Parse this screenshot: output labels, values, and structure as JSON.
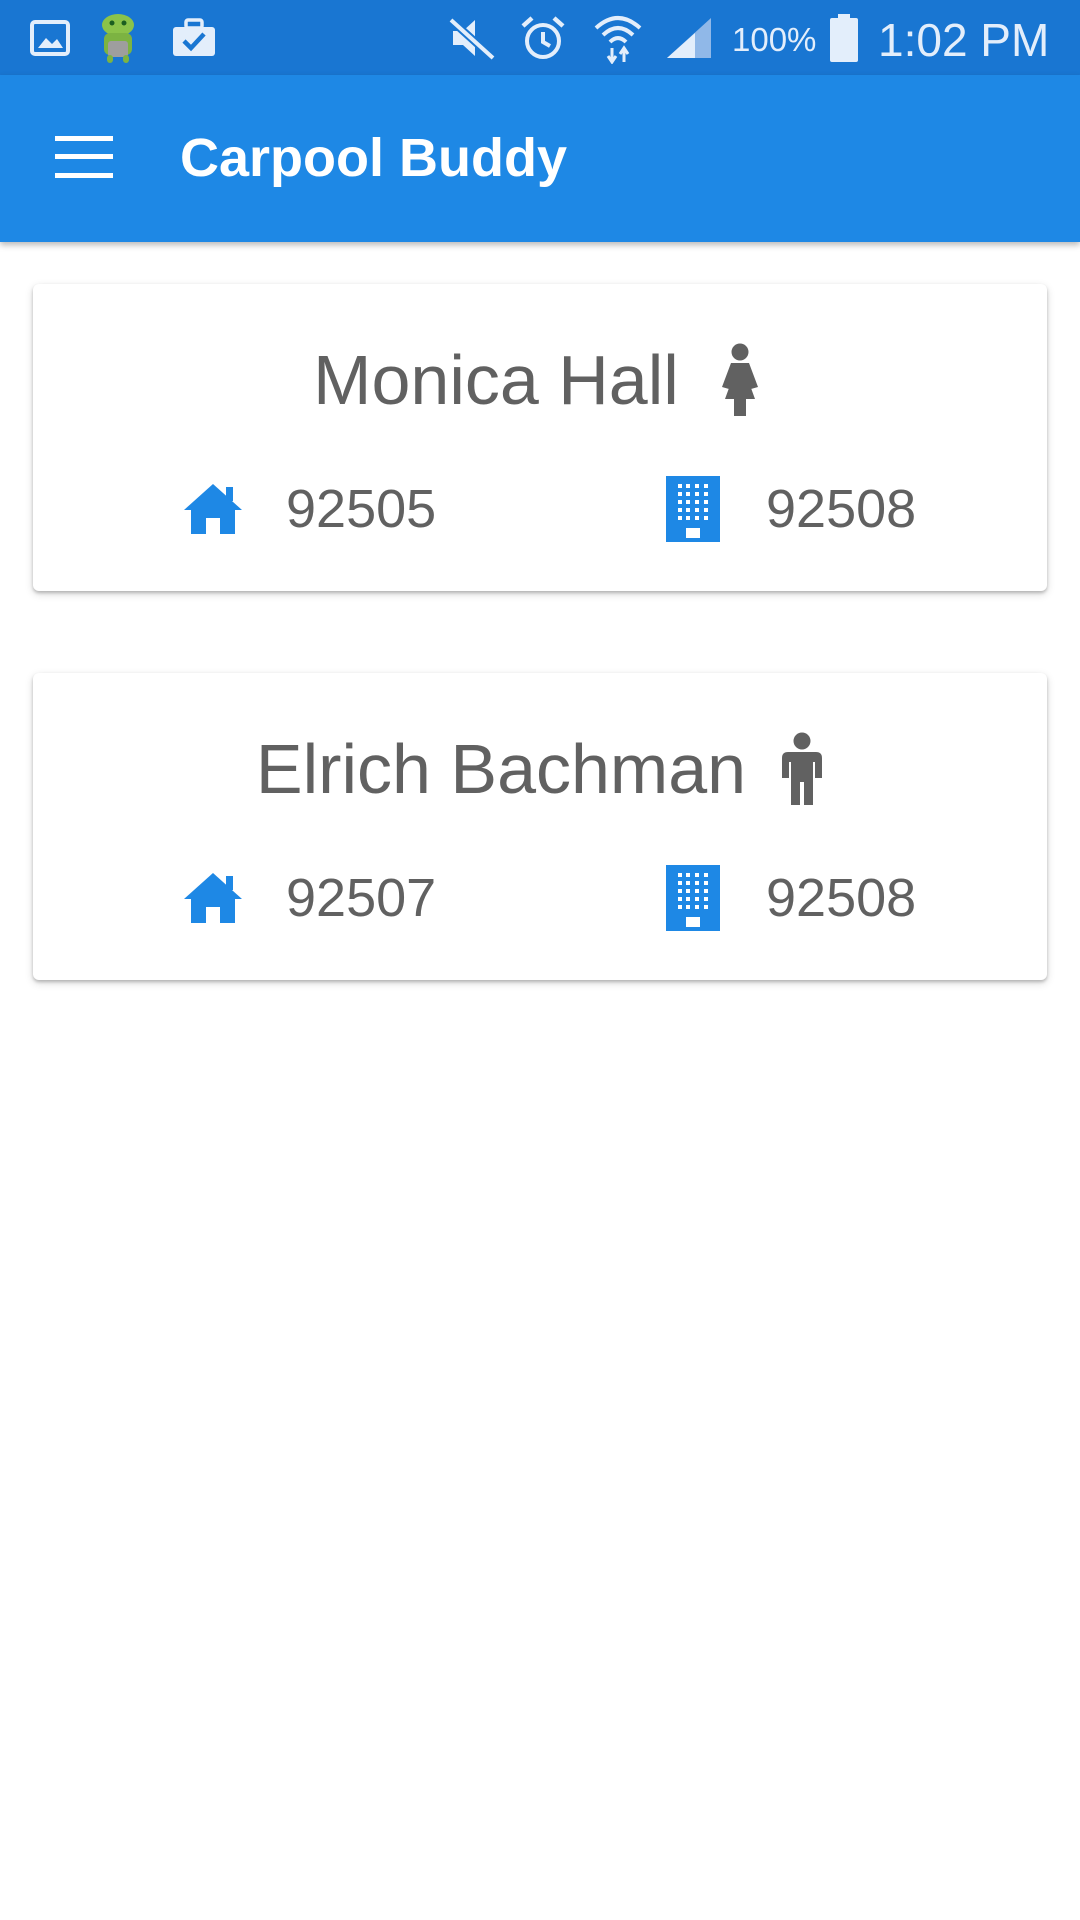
{
  "status_bar": {
    "icons": [
      "gallery-icon",
      "android-app-icon",
      "briefcase-check-icon",
      "mute-icon",
      "alarm-icon",
      "wifi-icon",
      "signal-icon",
      "battery-icon"
    ],
    "battery": "100%",
    "time": "1:02 PM"
  },
  "app_bar": {
    "menu_icon": "menu-icon",
    "title": "Carpool Buddy"
  },
  "colors": {
    "status_bar": "#1976d2",
    "app_bar": "#1e88e5",
    "accent": "#1e88e5",
    "text_secondary": "#616161"
  },
  "buddies": [
    {
      "name": "Monica Hall",
      "gender_icon": "female-icon",
      "home_icon": "home-icon",
      "home_zip": "92505",
      "work_icon": "office-building-icon",
      "work_zip": "92508"
    },
    {
      "name": "Elrich Bachman",
      "gender_icon": "male-icon",
      "home_icon": "home-icon",
      "home_zip": "92507",
      "work_icon": "office-building-icon",
      "work_zip": "92508"
    }
  ]
}
